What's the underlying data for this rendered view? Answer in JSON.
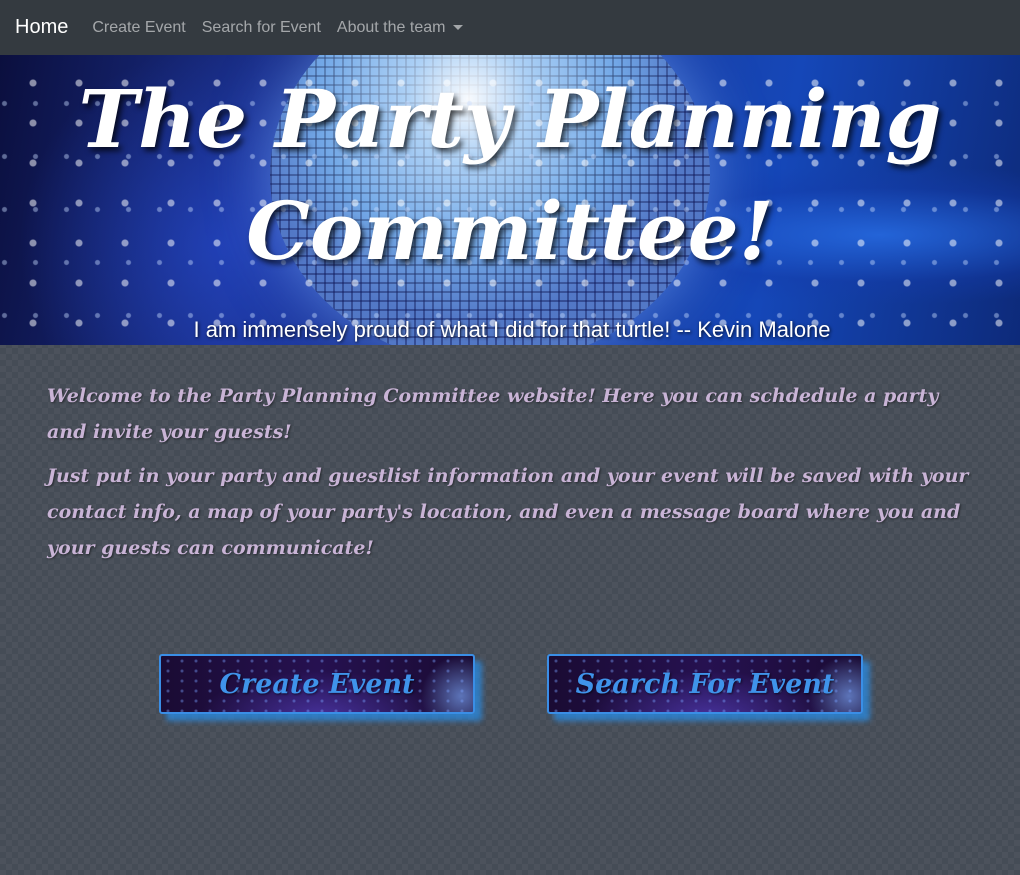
{
  "navbar": {
    "brand": "Home",
    "links": [
      {
        "label": "Create Event"
      },
      {
        "label": "Search for Event"
      },
      {
        "label": "About the team"
      }
    ]
  },
  "hero": {
    "title_line1": "The Party Planning",
    "title_line2": "Committee!",
    "quote": "I am immensely proud of what I did for that turtle! -- Kevin Malone"
  },
  "intro": {
    "paragraph1": "Welcome to the Party Planning Committee website! Here you can schdedule a party and invite your guests!",
    "paragraph2": "Just put in your party and guestlist information and your event will be saved with your contact info, a map of your party's location, and even a message board where you and your guests can communicate!"
  },
  "actions": {
    "create_label": "Create Event",
    "search_label": "Search For Event"
  },
  "colors": {
    "navbar_bg": "#343a40",
    "page_bg": "#454c56",
    "intro_text": "#c9b4d6",
    "button_text": "#3f93ea",
    "button_border": "#3a8ee6"
  }
}
